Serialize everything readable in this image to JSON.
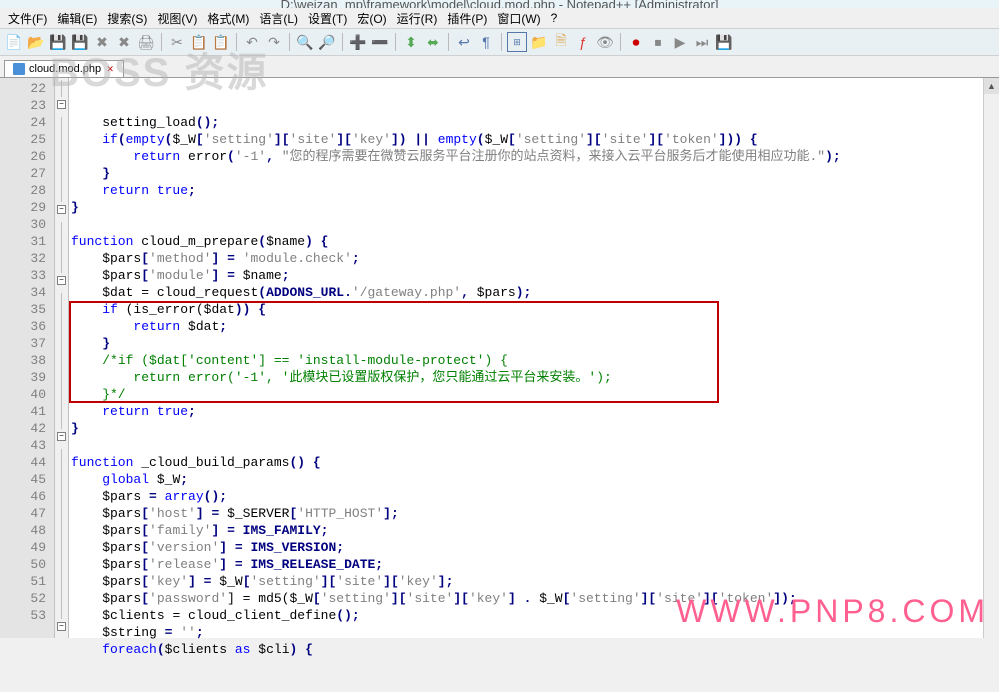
{
  "title": "D:\\weizan_mp\\framework\\model\\cloud.mod.php - Notepad++ [Administrator]",
  "menu": {
    "file": "文件(F)",
    "edit": "编辑(E)",
    "search": "搜索(S)",
    "view": "视图(V)",
    "format": "格式(M)",
    "language": "语言(L)",
    "settings": "设置(T)",
    "macro": "宏(O)",
    "run": "运行(R)",
    "plugins": "插件(P)",
    "window": "窗口(W)",
    "help": "?"
  },
  "tab": {
    "name": "cloud.mod.php",
    "close": "✕"
  },
  "watermark1": "BOSS 资源",
  "watermark2": "WWW.PNP8.COM",
  "lines": {
    "start": 22,
    "end": 53
  },
  "code": {
    "l22": {
      "a": "    setting_load",
      "b": "();"
    },
    "l23": {
      "a": "    ",
      "b": "if",
      "c": "(",
      "d": "empty",
      "e": "(",
      "f": "$_W",
      "g": "[",
      "h": "'setting'",
      "i": "][",
      "j": "'site'",
      "k": "][",
      "l": "'key'",
      "m": "]) || ",
      "n": "empty",
      "o": "(",
      "p": "$_W",
      "q": "[",
      "r": "'setting'",
      "s": "][",
      "t": "'site'",
      "u": "][",
      "v": "'token'",
      "w": "])) {"
    },
    "l24": {
      "a": "        ",
      "b": "return",
      "c": " error",
      "d": "(",
      "e": "'-1'",
      "f": ", ",
      "g": "\"您的程序需要在微赞云服务平台注册你的站点资料，来接入云平台服务后才能使用相应功能.\"",
      "h": ");"
    },
    "l25": {
      "a": "    }"
    },
    "l26": {
      "a": "    ",
      "b": "return true",
      "c": ";"
    },
    "l27": {
      "a": "}"
    },
    "l28": {
      "a": ""
    },
    "l29": {
      "a": "",
      "b": "function",
      "c": " cloud_m_prepare",
      "d": "(",
      "e": "$name",
      "f": ") {"
    },
    "l30": {
      "a": "    ",
      "b": "$pars",
      "c": "[",
      "d": "'method'",
      "e": "] = ",
      "f": "'module.check'",
      "g": ";"
    },
    "l31": {
      "a": "    ",
      "b": "$pars",
      "c": "[",
      "d": "'module'",
      "e": "] = ",
      "f": "$name",
      "g": ";"
    },
    "l32": {
      "a": "    ",
      "b": "$dat",
      "c": " = cloud_request",
      "d": "(ADDONS_URL.",
      "e": "'/gateway.php'",
      "f": ", ",
      "g": "$pars",
      "h": ");"
    },
    "l33": {
      "a": "    ",
      "b": "if",
      "c": " (is_error(",
      "d": "$dat",
      "e": ")) {"
    },
    "l34": {
      "a": "        ",
      "b": "return",
      "c": " ",
      "d": "$dat",
      "e": ";"
    },
    "l35": {
      "a": "    }"
    },
    "l36": {
      "a": "    ",
      "b": "/*if ($dat['content'] == 'install-module-protect') {"
    },
    "l37": {
      "a": "        return error('-1', '此模块已设置版权保护，您只能通过云平台来安装。');"
    },
    "l38": {
      "a": "    }*/"
    },
    "l39": {
      "a": "    ",
      "b": "return true",
      "c": ";"
    },
    "l40": {
      "a": "}"
    },
    "l41": {
      "a": ""
    },
    "l42": {
      "a": "",
      "b": "function",
      "c": " _cloud_build_params",
      "d": "() {"
    },
    "l43": {
      "a": "    ",
      "b": "global",
      "c": " ",
      "d": "$_W",
      "e": ";"
    },
    "l44": {
      "a": "    ",
      "b": "$pars",
      "c": " = ",
      "d": "array",
      "e": "();"
    },
    "l45": {
      "a": "    ",
      "b": "$pars",
      "c": "[",
      "d": "'host'",
      "e": "] = ",
      "f": "$_SERVER",
      "g": "[",
      "h": "'HTTP_HOST'",
      "i": "];"
    },
    "l46": {
      "a": "    ",
      "b": "$pars",
      "c": "[",
      "d": "'family'",
      "e": "] = IMS_FAMILY;"
    },
    "l47": {
      "a": "    ",
      "b": "$pars",
      "c": "[",
      "d": "'version'",
      "e": "] = IMS_VERSION;"
    },
    "l48": {
      "a": "    ",
      "b": "$pars",
      "c": "[",
      "d": "'release'",
      "e": "] = IMS_RELEASE_DATE;"
    },
    "l49": {
      "a": "    ",
      "b": "$pars",
      "c": "[",
      "d": "'key'",
      "e": "] = ",
      "f": "$_W",
      "g": "[",
      "h": "'setting'",
      "i": "][",
      "j": "'site'",
      "k": "][",
      "l": "'key'",
      "m": "];"
    },
    "l50": {
      "a": "    ",
      "b": "$pars",
      "c": "[",
      "d": "'password'",
      "e": "] = md5(",
      "f": "$_W",
      "g": "[",
      "h": "'setting'",
      "i": "][",
      "j": "'site'",
      "k": "][",
      "l": "'key'",
      "m": "] . ",
      "n": "$_W",
      "o": "[",
      "p": "'setting'",
      "q": "][",
      "r": "'site'",
      "s": "][",
      "t": "'token'",
      "u": "]);"
    },
    "l51": {
      "a": "    ",
      "b": "$clients",
      "c": " = cloud_client_define",
      "d": "();"
    },
    "l52": {
      "a": "    ",
      "b": "$string",
      "c": " = ",
      "d": "''",
      "e": ";"
    },
    "l53": {
      "a": "    ",
      "b": "foreach",
      "c": "(",
      "d": "$clients",
      "e": " ",
      "f": "as",
      "g": " ",
      "h": "$cli",
      "i": ") {"
    }
  }
}
